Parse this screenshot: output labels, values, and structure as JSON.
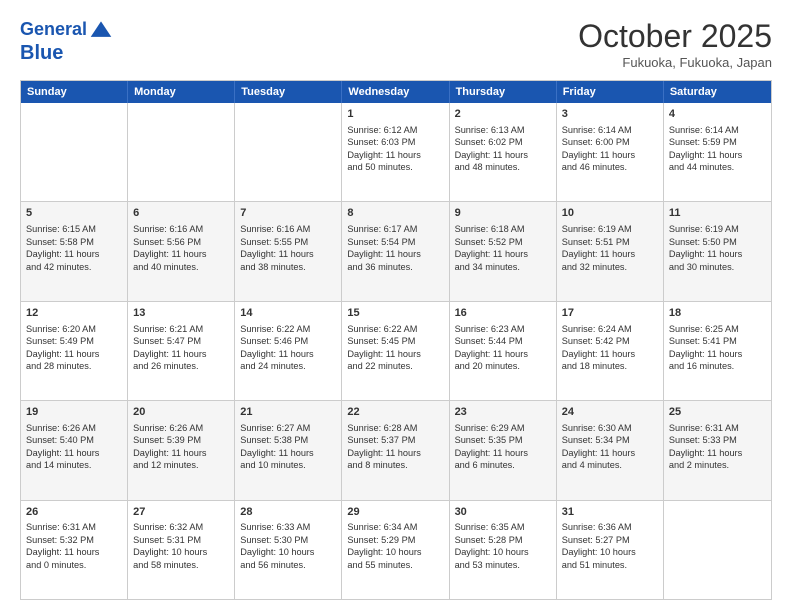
{
  "header": {
    "logo_line1": "General",
    "logo_line2": "Blue",
    "month": "October 2025",
    "location": "Fukuoka, Fukuoka, Japan"
  },
  "days_of_week": [
    "Sunday",
    "Monday",
    "Tuesday",
    "Wednesday",
    "Thursday",
    "Friday",
    "Saturday"
  ],
  "rows": [
    {
      "alt": false,
      "cells": [
        {
          "day": "",
          "lines": []
        },
        {
          "day": "",
          "lines": []
        },
        {
          "day": "",
          "lines": []
        },
        {
          "day": "1",
          "lines": [
            "Sunrise: 6:12 AM",
            "Sunset: 6:03 PM",
            "Daylight: 11 hours",
            "and 50 minutes."
          ]
        },
        {
          "day": "2",
          "lines": [
            "Sunrise: 6:13 AM",
            "Sunset: 6:02 PM",
            "Daylight: 11 hours",
            "and 48 minutes."
          ]
        },
        {
          "day": "3",
          "lines": [
            "Sunrise: 6:14 AM",
            "Sunset: 6:00 PM",
            "Daylight: 11 hours",
            "and 46 minutes."
          ]
        },
        {
          "day": "4",
          "lines": [
            "Sunrise: 6:14 AM",
            "Sunset: 5:59 PM",
            "Daylight: 11 hours",
            "and 44 minutes."
          ]
        }
      ]
    },
    {
      "alt": true,
      "cells": [
        {
          "day": "5",
          "lines": [
            "Sunrise: 6:15 AM",
            "Sunset: 5:58 PM",
            "Daylight: 11 hours",
            "and 42 minutes."
          ]
        },
        {
          "day": "6",
          "lines": [
            "Sunrise: 6:16 AM",
            "Sunset: 5:56 PM",
            "Daylight: 11 hours",
            "and 40 minutes."
          ]
        },
        {
          "day": "7",
          "lines": [
            "Sunrise: 6:16 AM",
            "Sunset: 5:55 PM",
            "Daylight: 11 hours",
            "and 38 minutes."
          ]
        },
        {
          "day": "8",
          "lines": [
            "Sunrise: 6:17 AM",
            "Sunset: 5:54 PM",
            "Daylight: 11 hours",
            "and 36 minutes."
          ]
        },
        {
          "day": "9",
          "lines": [
            "Sunrise: 6:18 AM",
            "Sunset: 5:52 PM",
            "Daylight: 11 hours",
            "and 34 minutes."
          ]
        },
        {
          "day": "10",
          "lines": [
            "Sunrise: 6:19 AM",
            "Sunset: 5:51 PM",
            "Daylight: 11 hours",
            "and 32 minutes."
          ]
        },
        {
          "day": "11",
          "lines": [
            "Sunrise: 6:19 AM",
            "Sunset: 5:50 PM",
            "Daylight: 11 hours",
            "and 30 minutes."
          ]
        }
      ]
    },
    {
      "alt": false,
      "cells": [
        {
          "day": "12",
          "lines": [
            "Sunrise: 6:20 AM",
            "Sunset: 5:49 PM",
            "Daylight: 11 hours",
            "and 28 minutes."
          ]
        },
        {
          "day": "13",
          "lines": [
            "Sunrise: 6:21 AM",
            "Sunset: 5:47 PM",
            "Daylight: 11 hours",
            "and 26 minutes."
          ]
        },
        {
          "day": "14",
          "lines": [
            "Sunrise: 6:22 AM",
            "Sunset: 5:46 PM",
            "Daylight: 11 hours",
            "and 24 minutes."
          ]
        },
        {
          "day": "15",
          "lines": [
            "Sunrise: 6:22 AM",
            "Sunset: 5:45 PM",
            "Daylight: 11 hours",
            "and 22 minutes."
          ]
        },
        {
          "day": "16",
          "lines": [
            "Sunrise: 6:23 AM",
            "Sunset: 5:44 PM",
            "Daylight: 11 hours",
            "and 20 minutes."
          ]
        },
        {
          "day": "17",
          "lines": [
            "Sunrise: 6:24 AM",
            "Sunset: 5:42 PM",
            "Daylight: 11 hours",
            "and 18 minutes."
          ]
        },
        {
          "day": "18",
          "lines": [
            "Sunrise: 6:25 AM",
            "Sunset: 5:41 PM",
            "Daylight: 11 hours",
            "and 16 minutes."
          ]
        }
      ]
    },
    {
      "alt": true,
      "cells": [
        {
          "day": "19",
          "lines": [
            "Sunrise: 6:26 AM",
            "Sunset: 5:40 PM",
            "Daylight: 11 hours",
            "and 14 minutes."
          ]
        },
        {
          "day": "20",
          "lines": [
            "Sunrise: 6:26 AM",
            "Sunset: 5:39 PM",
            "Daylight: 11 hours",
            "and 12 minutes."
          ]
        },
        {
          "day": "21",
          "lines": [
            "Sunrise: 6:27 AM",
            "Sunset: 5:38 PM",
            "Daylight: 11 hours",
            "and 10 minutes."
          ]
        },
        {
          "day": "22",
          "lines": [
            "Sunrise: 6:28 AM",
            "Sunset: 5:37 PM",
            "Daylight: 11 hours",
            "and 8 minutes."
          ]
        },
        {
          "day": "23",
          "lines": [
            "Sunrise: 6:29 AM",
            "Sunset: 5:35 PM",
            "Daylight: 11 hours",
            "and 6 minutes."
          ]
        },
        {
          "day": "24",
          "lines": [
            "Sunrise: 6:30 AM",
            "Sunset: 5:34 PM",
            "Daylight: 11 hours",
            "and 4 minutes."
          ]
        },
        {
          "day": "25",
          "lines": [
            "Sunrise: 6:31 AM",
            "Sunset: 5:33 PM",
            "Daylight: 11 hours",
            "and 2 minutes."
          ]
        }
      ]
    },
    {
      "alt": false,
      "cells": [
        {
          "day": "26",
          "lines": [
            "Sunrise: 6:31 AM",
            "Sunset: 5:32 PM",
            "Daylight: 11 hours",
            "and 0 minutes."
          ]
        },
        {
          "day": "27",
          "lines": [
            "Sunrise: 6:32 AM",
            "Sunset: 5:31 PM",
            "Daylight: 10 hours",
            "and 58 minutes."
          ]
        },
        {
          "day": "28",
          "lines": [
            "Sunrise: 6:33 AM",
            "Sunset: 5:30 PM",
            "Daylight: 10 hours",
            "and 56 minutes."
          ]
        },
        {
          "day": "29",
          "lines": [
            "Sunrise: 6:34 AM",
            "Sunset: 5:29 PM",
            "Daylight: 10 hours",
            "and 55 minutes."
          ]
        },
        {
          "day": "30",
          "lines": [
            "Sunrise: 6:35 AM",
            "Sunset: 5:28 PM",
            "Daylight: 10 hours",
            "and 53 minutes."
          ]
        },
        {
          "day": "31",
          "lines": [
            "Sunrise: 6:36 AM",
            "Sunset: 5:27 PM",
            "Daylight: 10 hours",
            "and 51 minutes."
          ]
        },
        {
          "day": "",
          "lines": []
        }
      ]
    }
  ]
}
